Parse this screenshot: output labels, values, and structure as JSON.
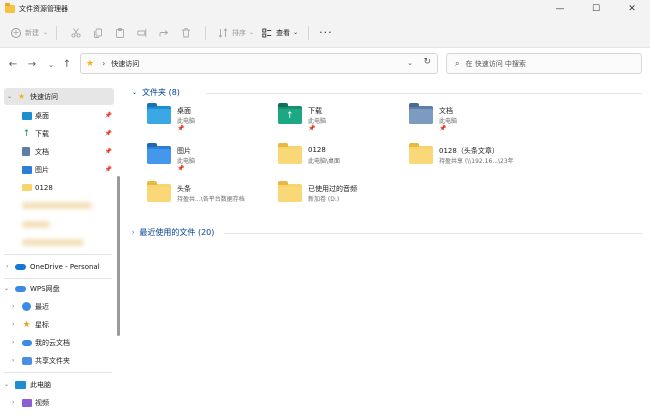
{
  "window": {
    "title": "文件资源管理器",
    "minimize_glyph": "—",
    "maximize_glyph": "☐",
    "close_glyph": "✕"
  },
  "toolbar": {
    "new_label": "新建",
    "new_glyph": "+",
    "new_chevron": "⌄",
    "sort_label": "排序",
    "view_label": "查看",
    "chevron": "⌄",
    "more_glyph": "···",
    "icons": [
      "cut-icon",
      "copy-icon",
      "paste-icon",
      "rename-icon",
      "share-icon",
      "delete-icon",
      "sort-icon",
      "view-icon"
    ]
  },
  "address": {
    "back_glyph": "←",
    "forward_glyph": "→",
    "recent_glyph": "⌄",
    "up_glyph": "↑",
    "star_glyph": "★",
    "crumb_chevron": "›",
    "location": "快速访问",
    "dropdown_glyph": "⌄",
    "refresh_glyph": "↻",
    "search_glyph": "⌕",
    "search_placeholder": "在 快速访问 中搜索"
  },
  "sidebar": {
    "pin_glyph": "📌",
    "expand_glyph": "›",
    "collapse_glyph": "⌄",
    "quick_access": "快速访问",
    "quick_items": [
      {
        "label": "桌面",
        "icon": "desktop-icon",
        "pinned": true
      },
      {
        "label": "下载",
        "icon": "download-icon",
        "pinned": true
      },
      {
        "label": "文档",
        "icon": "documents-icon",
        "pinned": true
      },
      {
        "label": "图片",
        "icon": "pictures-icon",
        "pinned": true
      },
      {
        "label": "0128",
        "icon": "folder-icon",
        "pinned": false
      }
    ],
    "onedrive": "OneDrive - Personal",
    "wps": "WPS网盘",
    "wps_items": [
      {
        "label": "最近",
        "icon": "recent-icon"
      },
      {
        "label": "星标",
        "icon": "star-icon"
      },
      {
        "label": "我的云文档",
        "icon": "cloud-doc-icon"
      },
      {
        "label": "共享文件夹",
        "icon": "shared-folder-icon"
      }
    ],
    "this_pc": "此电脑",
    "pc_items": [
      {
        "label": "视频",
        "icon": "videos-icon"
      }
    ]
  },
  "content": {
    "folders_header": "文件夹 (8)",
    "recent_header": "最近使用的文件 (20)",
    "folders": [
      {
        "name": "桌面",
        "location": "此电脑",
        "pinned": true,
        "icon": "desktop-folder-icon"
      },
      {
        "name": "下载",
        "location": "此电脑",
        "pinned": true,
        "icon": "download-folder-icon"
      },
      {
        "name": "文档",
        "location": "此电脑",
        "pinned": true,
        "icon": "documents-folder-icon"
      },
      {
        "name": "图片",
        "location": "此电脑",
        "pinned": true,
        "icon": "pictures-folder-icon"
      },
      {
        "name": "0128",
        "location": "此电脑\\桌面",
        "pinned": false,
        "icon": "folder-icon"
      },
      {
        "name": "0128（头条文章）",
        "location": "持盈共享 (\\\\192.16...\\23年",
        "pinned": false,
        "icon": "folder-icon"
      },
      {
        "name": "头条",
        "location": "持盈共...\\各平台数据存档",
        "pinned": false,
        "icon": "folder-icon"
      },
      {
        "name": "已使用过的音频",
        "location": "新加卷 (D:)",
        "pinned": false,
        "icon": "folder-icon"
      }
    ]
  },
  "colors": {
    "accent": "#003e92",
    "folder_yellow": "#f8d46c",
    "star": "#f0b51a"
  }
}
